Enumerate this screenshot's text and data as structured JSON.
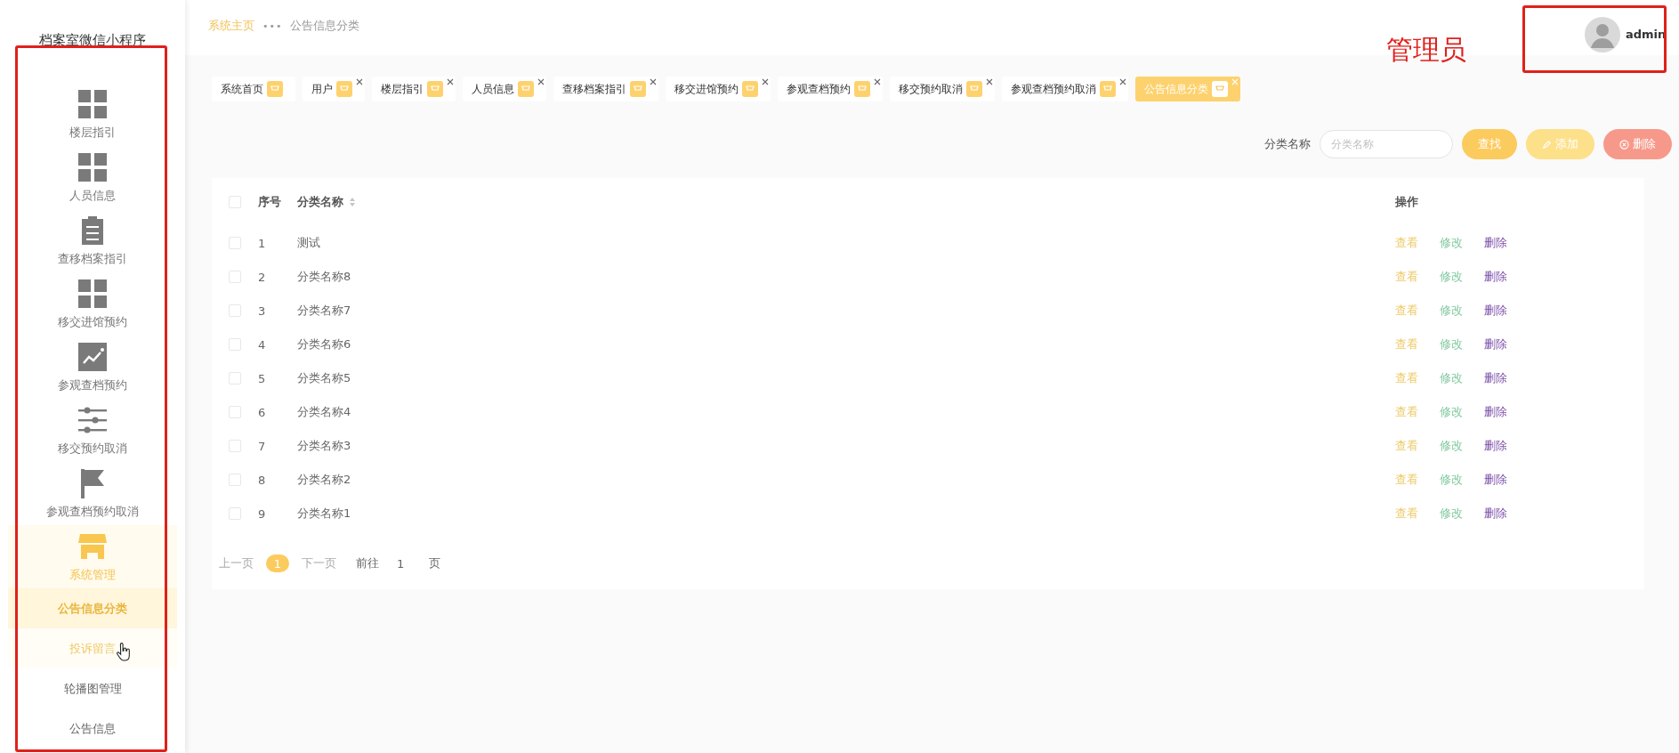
{
  "sidebar": {
    "title": "档案室微信小程序",
    "items": [
      {
        "label": "楼层指引",
        "selected": false
      },
      {
        "label": "人员信息",
        "selected": false
      },
      {
        "label": "查移档案指引",
        "selected": false
      },
      {
        "label": "移交进馆预约",
        "selected": false
      },
      {
        "label": "参观查档预约",
        "selected": false
      },
      {
        "label": "移交预约取消",
        "selected": false
      },
      {
        "label": "参观查档预约取消",
        "selected": false
      },
      {
        "label": "系统管理",
        "selected": true,
        "children": [
          {
            "label": "公告信息分类",
            "selected": true,
            "hover": false
          },
          {
            "label": "投诉留言",
            "selected": false,
            "hover": true
          },
          {
            "label": "轮播图管理",
            "selected": false,
            "hover": false
          },
          {
            "label": "公告信息",
            "selected": false,
            "hover": false
          }
        ]
      }
    ]
  },
  "breadcrumb": {
    "home": "系统主页",
    "separator": "•••",
    "current": "公告信息分类"
  },
  "user": {
    "name": "admin"
  },
  "annotation": {
    "label": "管理员"
  },
  "tabs": [
    {
      "label": "系统首页",
      "selected": false,
      "closable": false
    },
    {
      "label": "用户",
      "selected": false,
      "closable": true
    },
    {
      "label": "楼层指引",
      "selected": false,
      "closable": true
    },
    {
      "label": "人员信息",
      "selected": false,
      "closable": true
    },
    {
      "label": "查移档案指引",
      "selected": false,
      "closable": true
    },
    {
      "label": "移交进馆预约",
      "selected": false,
      "closable": true
    },
    {
      "label": "参观查档预约",
      "selected": false,
      "closable": true
    },
    {
      "label": "移交预约取消",
      "selected": false,
      "closable": true
    },
    {
      "label": "参观查档预约取消",
      "selected": false,
      "closable": true
    },
    {
      "label": "公告信息分类",
      "selected": true,
      "closable": true
    }
  ],
  "search": {
    "label": "分类名称",
    "placeholder": "分类名称",
    "buttons": [
      {
        "label": "查找",
        "kind": "search"
      },
      {
        "label": "添加",
        "kind": "add"
      },
      {
        "label": "删除",
        "kind": "delete"
      }
    ]
  },
  "table": {
    "columns": [
      "序号",
      "分类名称",
      "操作"
    ],
    "header_checked": false,
    "rows": [
      {
        "index": "1",
        "name": "测试",
        "checked": false,
        "actions": [
          {
            "label": "查看",
            "kind": "view"
          },
          {
            "label": "修改",
            "kind": "edit"
          },
          {
            "label": "删除",
            "kind": "delete"
          }
        ]
      },
      {
        "index": "2",
        "name": "分类名称8",
        "checked": false,
        "actions": [
          {
            "label": "查看",
            "kind": "view"
          },
          {
            "label": "修改",
            "kind": "edit"
          },
          {
            "label": "删除",
            "kind": "delete"
          }
        ]
      },
      {
        "index": "3",
        "name": "分类名称7",
        "checked": false,
        "actions": [
          {
            "label": "查看",
            "kind": "view"
          },
          {
            "label": "修改",
            "kind": "edit"
          },
          {
            "label": "删除",
            "kind": "delete"
          }
        ]
      },
      {
        "index": "4",
        "name": "分类名称6",
        "checked": false,
        "actions": [
          {
            "label": "查看",
            "kind": "view"
          },
          {
            "label": "修改",
            "kind": "edit"
          },
          {
            "label": "删除",
            "kind": "delete"
          }
        ]
      },
      {
        "index": "5",
        "name": "分类名称5",
        "checked": false,
        "actions": [
          {
            "label": "查看",
            "kind": "view"
          },
          {
            "label": "修改",
            "kind": "edit"
          },
          {
            "label": "删除",
            "kind": "delete"
          }
        ]
      },
      {
        "index": "6",
        "name": "分类名称4",
        "checked": false,
        "actions": [
          {
            "label": "查看",
            "kind": "view"
          },
          {
            "label": "修改",
            "kind": "edit"
          },
          {
            "label": "删除",
            "kind": "delete"
          }
        ]
      },
      {
        "index": "7",
        "name": "分类名称3",
        "checked": false,
        "actions": [
          {
            "label": "查看",
            "kind": "view"
          },
          {
            "label": "修改",
            "kind": "edit"
          },
          {
            "label": "删除",
            "kind": "delete"
          }
        ]
      },
      {
        "index": "8",
        "name": "分类名称2",
        "checked": false,
        "actions": [
          {
            "label": "查看",
            "kind": "view"
          },
          {
            "label": "修改",
            "kind": "edit"
          },
          {
            "label": "删除",
            "kind": "delete"
          }
        ]
      },
      {
        "index": "9",
        "name": "分类名称1",
        "checked": false,
        "actions": [
          {
            "label": "查看",
            "kind": "view"
          },
          {
            "label": "修改",
            "kind": "edit"
          },
          {
            "label": "删除",
            "kind": "delete"
          }
        ]
      }
    ]
  },
  "pagination": {
    "prev": "上一页",
    "pages": [
      {
        "label": "1",
        "selected": true
      }
    ],
    "next": "下一页",
    "goto": "前往",
    "goto_value": "1",
    "suffix": "页"
  }
}
